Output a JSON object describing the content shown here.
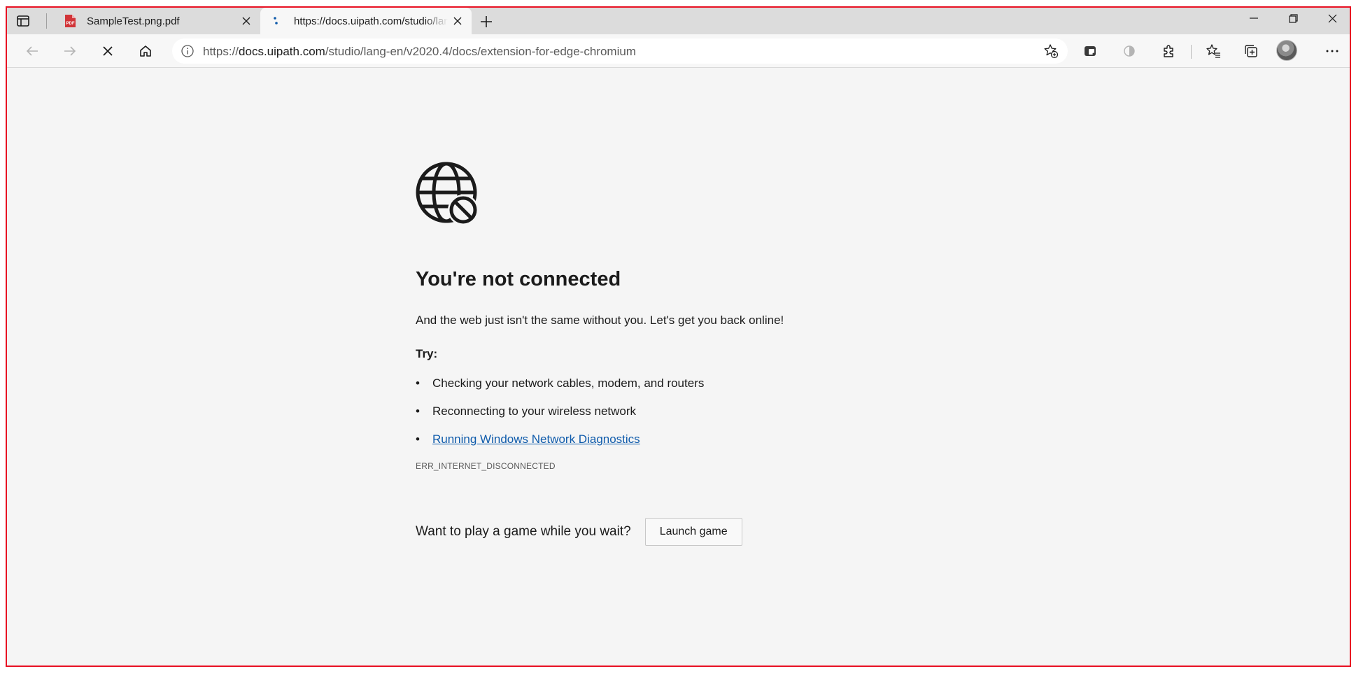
{
  "browser": {
    "tabs": [
      {
        "title": "SampleTest.png.pdf",
        "icon": "pdf-icon",
        "active": false
      },
      {
        "title": "https://docs.uipath.com/studio/lang-en/v2020.4/docs/extension-for-edge-chromium",
        "icon": "loading-spinner-icon",
        "active": true
      }
    ],
    "address": {
      "url_prefix": "https://",
      "url_host": "docs.uipath.com",
      "url_path": "/studio/lang-en/v2020.4/docs/extension-for-edge-chromium"
    },
    "colors": {
      "frame_border": "#e81123",
      "link": "#0f5bab",
      "pdf_red": "#d13438"
    }
  },
  "page": {
    "heading": "You're not connected",
    "lead": "And the web just isn't the same without you. Let's get you back online!",
    "try_label": "Try:",
    "suggestions": [
      "Checking your network cables, modem, and routers",
      "Reconnecting to your wireless network"
    ],
    "diagnostics_link": "Running Windows Network Diagnostics",
    "error_code": "ERR_INTERNET_DISCONNECTED",
    "game_prompt": "Want to play a game while you wait?",
    "game_button": "Launch game"
  }
}
